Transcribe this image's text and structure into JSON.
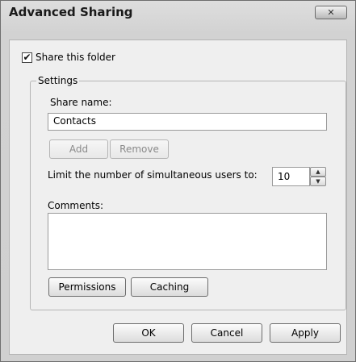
{
  "window": {
    "title": "Advanced Sharing",
    "close_glyph": "✕"
  },
  "share": {
    "checked": true,
    "check_glyph": "✔",
    "label": "Share this folder"
  },
  "settings": {
    "legend": "Settings",
    "share_name_label": "Share name:",
    "share_name_value": "Contacts",
    "add_label": "Add",
    "remove_label": "Remove",
    "limit_label": "Limit the number of simultaneous users to:",
    "limit_value": "10",
    "spin_up_glyph": "▲",
    "spin_down_glyph": "▼",
    "comments_label": "Comments:",
    "comments_value": "",
    "permissions_label": "Permissions",
    "caching_label": "Caching"
  },
  "footer": {
    "ok_label": "OK",
    "cancel_label": "Cancel",
    "apply_label": "Apply"
  }
}
